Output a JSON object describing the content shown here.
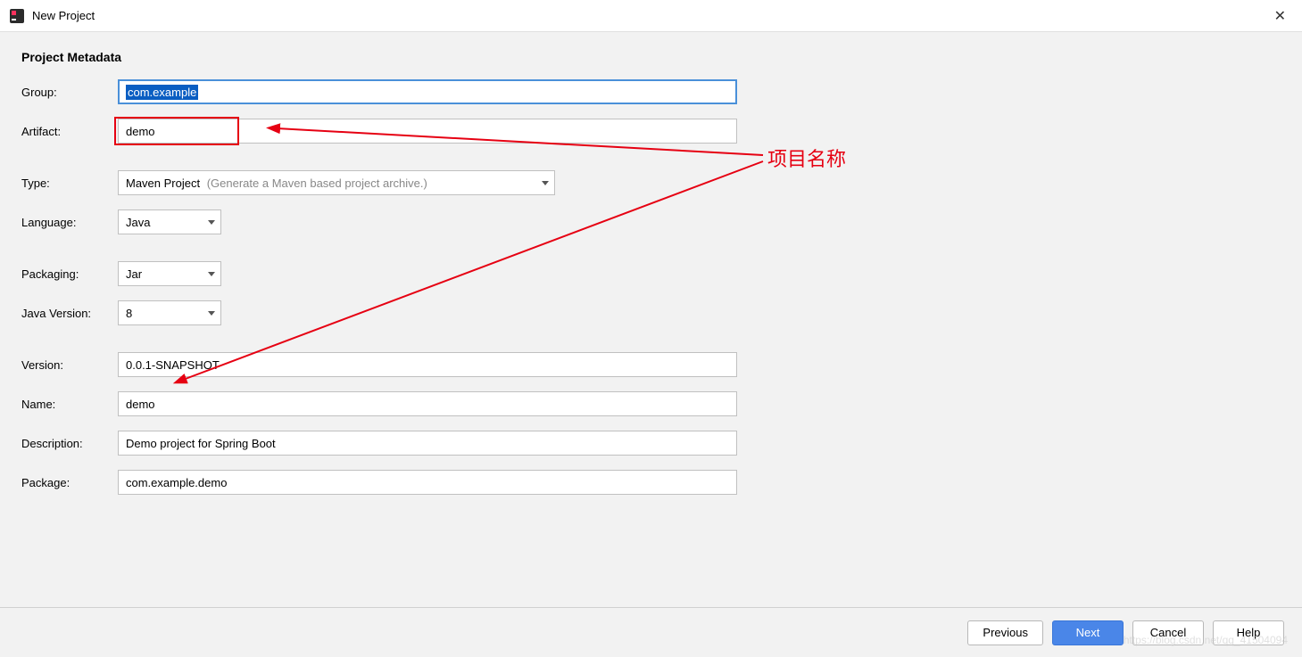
{
  "window": {
    "title": "New Project"
  },
  "section_title": "Project Metadata",
  "fields": {
    "group": {
      "label": "Group:",
      "value": "com.example"
    },
    "artifact": {
      "label": "Artifact:",
      "value": "demo"
    },
    "type": {
      "label": "Type:",
      "value": "Maven Project",
      "hint": "(Generate a Maven based project archive.)"
    },
    "language": {
      "label": "Language:",
      "value": "Java"
    },
    "packaging": {
      "label": "Packaging:",
      "value": "Jar"
    },
    "java_version": {
      "label": "Java Version:",
      "value": "8"
    },
    "version": {
      "label": "Version:",
      "value": "0.0.1-SNAPSHOT"
    },
    "name": {
      "label": "Name:",
      "value": "demo"
    },
    "description": {
      "label": "Description:",
      "value": "Demo project for Spring Boot"
    },
    "package": {
      "label": "Package:",
      "value": "com.example.demo"
    }
  },
  "annotation": {
    "text": "项目名称"
  },
  "buttons": {
    "previous": "Previous",
    "next": "Next",
    "cancel": "Cancel",
    "help": "Help"
  },
  "watermark": "https://blog.csdn.net/qq_41504094"
}
